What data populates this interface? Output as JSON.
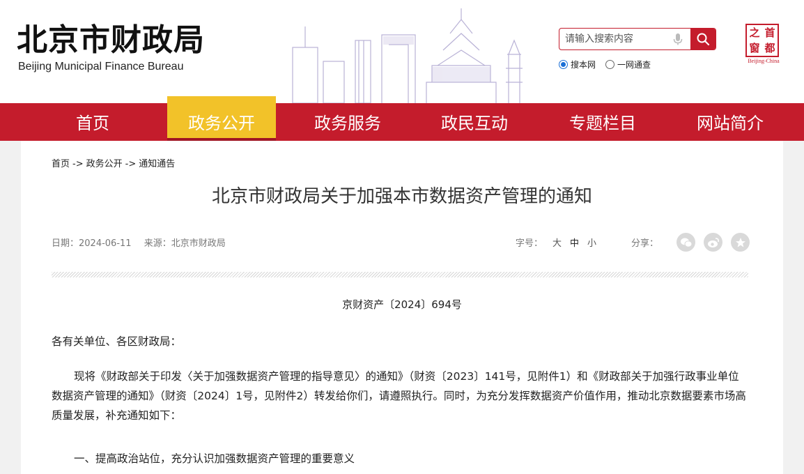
{
  "header": {
    "title": "北京市财政局",
    "subtitle": "Beijing Municipal Finance Bureau"
  },
  "search": {
    "placeholder": "请输入搜索内容",
    "scope_site": "搜本网",
    "scope_all": "一网通查",
    "selected_scope": "搜本网"
  },
  "seal": {
    "chars": [
      "首",
      "都",
      "之",
      "窗"
    ],
    "caption": "Beijing-China"
  },
  "nav": {
    "items": [
      "首页",
      "政务公开",
      "政务服务",
      "政民互动",
      "专题栏目",
      "网站简介"
    ],
    "active": "政务公开"
  },
  "breadcrumb": {
    "items": [
      "首页",
      "政务公开",
      "通知通告"
    ],
    "separator": "->"
  },
  "article": {
    "title": "北京市财政局关于加强本市数据资产管理的通知",
    "date": "日期：2024-06-11",
    "source": "来源：北京市财政局",
    "font_size_label": "字号：",
    "font_size_options": [
      "大",
      "中",
      "小"
    ],
    "font_size_current": "中",
    "share_label": "分享：",
    "share_targets": [
      "wechat-icon",
      "weibo-icon",
      "favorite-icon"
    ],
    "doc_number": "京财资产〔2024〕694号",
    "salutation": "各有关单位、各区财政局：",
    "paragraph1": "现将《财政部关于印发〈关于加强数据资产管理的指导意见〉的通知》（财资〔2023〕141号，见附件1）和《财政部关于加强行政事业单位数据资产管理的通知》（财资〔2024〕1号，见附件2）转发给你们，请遵照执行。同时，为充分发挥数据资产价值作用，推动北京数据要素市场高质量发展，补充通知如下：",
    "section1": "一、提高政治站位，充分认识加强数据资产管理的重要意义"
  },
  "colors": {
    "brand_red": "#c41c2c",
    "nav_active": "#f2c229",
    "page_bg": "#f1f1f1"
  }
}
